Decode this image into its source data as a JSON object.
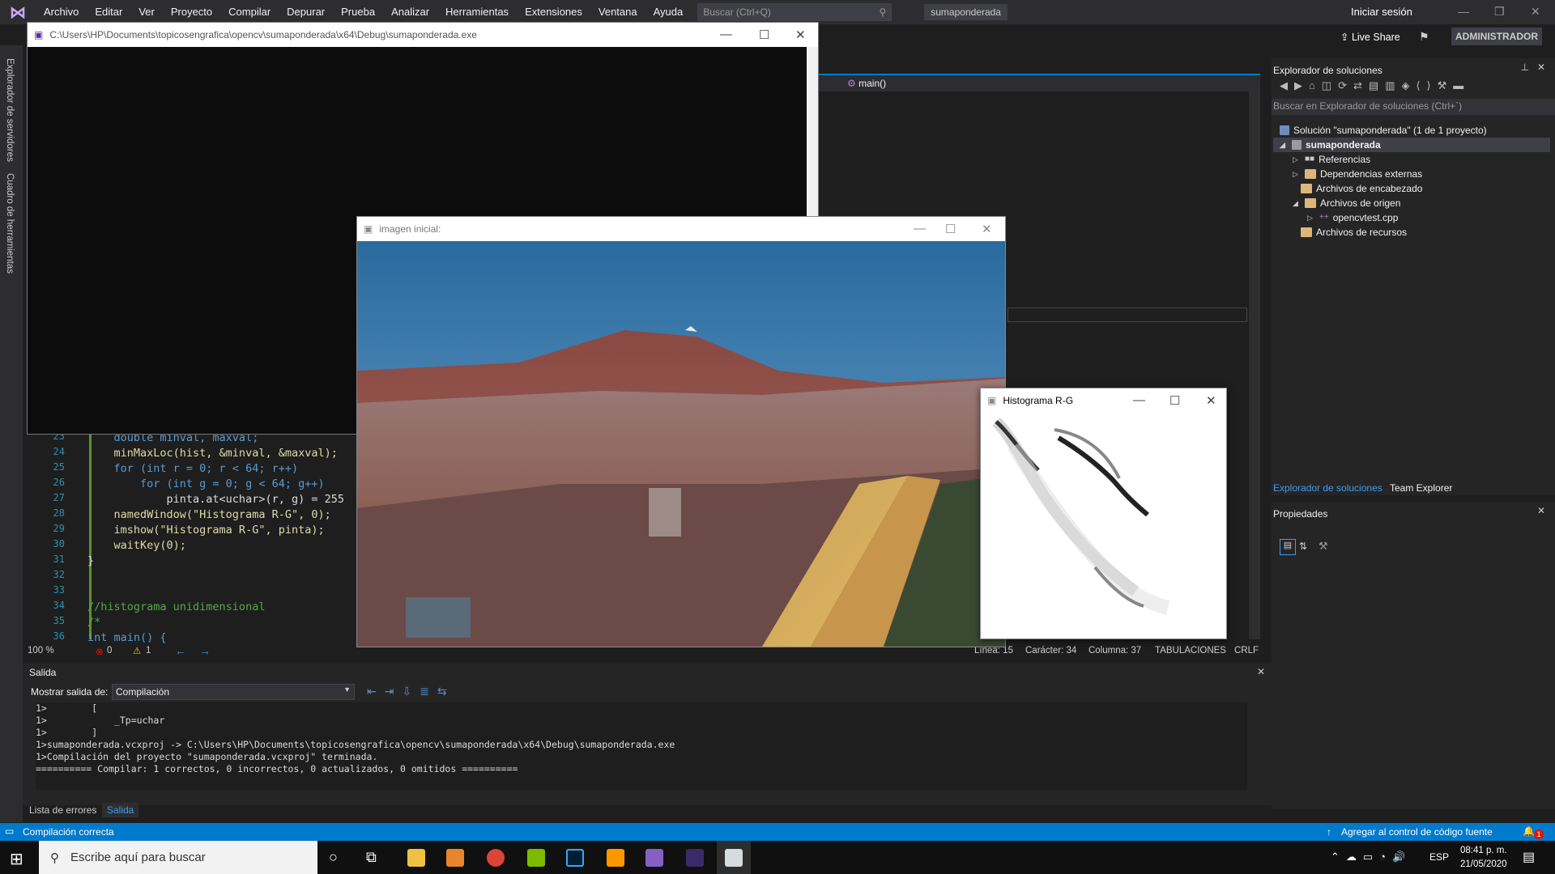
{
  "menu": [
    "Archivo",
    "Editar",
    "Ver",
    "Proyecto",
    "Compilar",
    "Depurar",
    "Prueba",
    "Analizar",
    "Herramientas",
    "Extensiones",
    "Ventana",
    "Ayuda"
  ],
  "search_placeholder": "Buscar (Ctrl+Q)",
  "solution_name": "sumaponderada",
  "signin": "Iniciar sesión",
  "liveshare": "Live Share",
  "admin": "ADMINISTRADOR",
  "left_tabs": [
    "Explorador de servidores",
    "Cuadro de herramientas"
  ],
  "editor": {
    "function_dropdown": "main()",
    "lines": [
      {
        "n": "23",
        "code": "    double minval, maxval;"
      },
      {
        "n": "24",
        "code": "    minMaxLoc(hist, &minval, &maxval);"
      },
      {
        "n": "25",
        "code": "    for (int r = 0; r < 64; r++)"
      },
      {
        "n": "26",
        "code": "        for (int g = 0; g < 64; g++)"
      },
      {
        "n": "27",
        "code": "            pinta.at<uchar>(r, g) = 255"
      },
      {
        "n": "28",
        "code": "    namedWindow(\"Histograma R-G\", 0);"
      },
      {
        "n": "29",
        "code": "    imshow(\"Histograma R-G\", pinta);"
      },
      {
        "n": "30",
        "code": "    waitKey(0);"
      },
      {
        "n": "31",
        "code": "}"
      },
      {
        "n": "32",
        "code": ""
      },
      {
        "n": "33",
        "code": ""
      },
      {
        "n": "34",
        "code": "//histograma unidimensional"
      },
      {
        "n": "35",
        "code": "/*"
      },
      {
        "n": "36",
        "code": "int main() {"
      }
    ],
    "zoom": "100 %",
    "errors": "0",
    "warnings": "1",
    "line": "Línea: 15",
    "char": "Carácter: 34",
    "col": "Columna: 37",
    "tabs": "TABULACIONES",
    "eol": "CRLF"
  },
  "solution_explorer": {
    "title": "Explorador de soluciones",
    "search": "Buscar en Explorador de soluciones (Ctrl+`)",
    "items": [
      {
        "label": "Solución \"sumaponderada\" (1 de 1 proyecto)",
        "bold": false
      },
      {
        "label": "sumaponderada",
        "bold": true
      },
      {
        "label": "Referencias",
        "bold": false
      },
      {
        "label": "Dependencias externas",
        "bold": false
      },
      {
        "label": "Archivos de encabezado",
        "bold": false
      },
      {
        "label": "Archivos de origen",
        "bold": false
      },
      {
        "label": "opencvtest.cpp",
        "bold": false
      },
      {
        "label": "Archivos de recursos",
        "bold": false
      }
    ],
    "tab_active": "Explorador de soluciones",
    "tab_other": "Team Explorer"
  },
  "properties_title": "Propiedades",
  "output": {
    "title": "Salida",
    "show_from": "Mostrar salida de:",
    "source": "Compilación",
    "lines": [
      "1>        [",
      "1>            _Tp=uchar",
      "1>        ]",
      "1>sumaponderada.vcxproj -> C:\\Users\\HP\\Documents\\topicosengrafica\\opencv\\sumaponderada\\x64\\Debug\\sumaponderada.exe",
      "1>Compilación del proyecto \"sumaponderada.vcxproj\" terminada.",
      "========== Compilar: 1 correctos, 0 incorrectos, 0 actualizados, 0 omitidos =========="
    ],
    "tab_errors": "Lista de errores",
    "tab_output": "Salida"
  },
  "status": {
    "left": "Compilación correcta",
    "right": "Agregar al control de código fuente",
    "notif": "1"
  },
  "console_title": "C:\\Users\\HP\\Documents\\topicosengrafica\\opencv\\sumaponderada\\x64\\Debug\\sumaponderada.exe",
  "image_title": "imagen inicial:",
  "hist_title": "Histograma R-G",
  "taskbar": {
    "search": "Escribe aquí para buscar",
    "lang": "ESP",
    "time": "08:41 p. m.",
    "date": "21/05/2020"
  },
  "colors": {
    "accent": "#007acc",
    "bg": "#1e1e1e",
    "panel": "#252526"
  }
}
